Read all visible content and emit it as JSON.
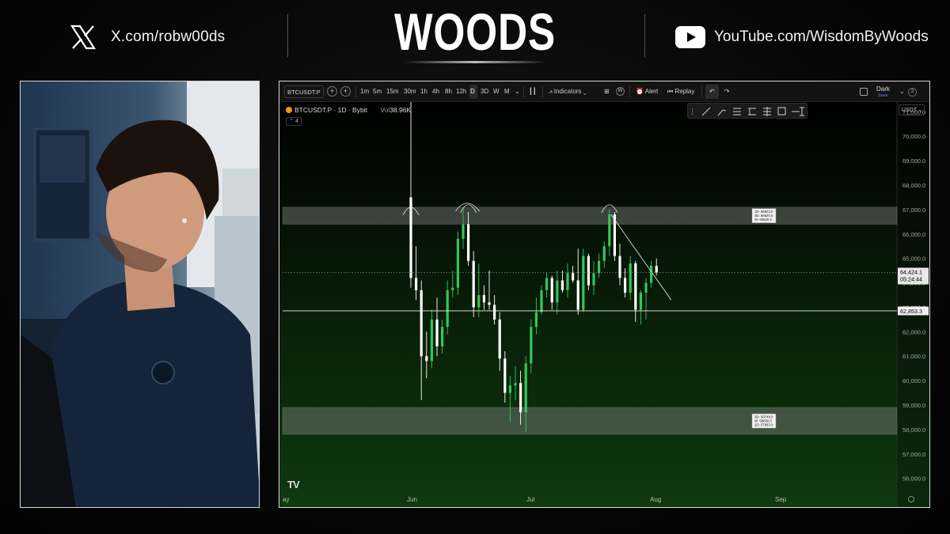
{
  "header": {
    "x_handle": "X.com/robw00ds",
    "brand": "WOODS",
    "youtube_handle": "YouTube.com/WisdomByWoods"
  },
  "icons": {
    "x": "x-logo-icon",
    "youtube": "youtube-play-icon"
  },
  "toolbar": {
    "symbol": "BTCUSDT.P",
    "intervals": [
      "1m",
      "5m",
      "15m",
      "30m",
      "1h",
      "4h",
      "8h",
      "12h",
      "D",
      "3D",
      "W",
      "M"
    ],
    "selected_interval": "D",
    "indicators_label": "Indicators",
    "alert_label": "Alert",
    "replay_label": "Replay",
    "theme_label": "Dark",
    "save_label": "Save",
    "layout_count": "2"
  },
  "legend": {
    "symbol_line": "BTCUSDT.P · 1D · Bybit",
    "vol_label": "Vol",
    "vol_value": "38.96K",
    "collapse_count": "4"
  },
  "price_scale": {
    "currency": "USDT"
  },
  "colors": {
    "up": "#34c759",
    "down": "#ffffff",
    "zone": "#8a8a8a",
    "background_top": "#000000",
    "background_bottom": "#0f3a0f"
  },
  "chart_data": {
    "type": "candlestick",
    "instrument": "BTCUSDT.P",
    "timeframe": "1D",
    "exchange": "Bybit",
    "y_ticks": [
      56000,
      57000,
      58000,
      59000,
      60000,
      61000,
      62000,
      63000,
      64000,
      65000,
      66000,
      67000,
      68000,
      69000,
      70000,
      71000
    ],
    "ylim": [
      55600,
      71400
    ],
    "x_tick_labels": [
      "ay",
      "Jun",
      "Jul",
      "Aug",
      "Sep"
    ],
    "last_price": "64,424.1",
    "countdown": "05:24:44",
    "horizontal_line": "62,853.3",
    "zones": [
      {
        "from": 66400,
        "to": 67100,
        "labels": [
          "1D: 66922.0",
          "3D: 66520.0",
          "W: 66520.0"
        ]
      },
      {
        "from": 57800,
        "to": 58900,
        "labels": [
          "3D: 58748.0",
          "W: 58650.0",
          "1D: 57993.0"
        ]
      }
    ],
    "candles": [
      {
        "o": 67500,
        "h": 71500,
        "l": 63800,
        "c": 64200
      },
      {
        "o": 64200,
        "h": 65500,
        "l": 63300,
        "c": 63700
      },
      {
        "o": 63700,
        "h": 64100,
        "l": 59200,
        "c": 61000
      },
      {
        "o": 61000,
        "h": 62000,
        "l": 60100,
        "c": 60800
      },
      {
        "o": 60800,
        "h": 62900,
        "l": 60500,
        "c": 62500
      },
      {
        "o": 62500,
        "h": 63400,
        "l": 61000,
        "c": 61400
      },
      {
        "o": 61400,
        "h": 62500,
        "l": 61100,
        "c": 62200
      },
      {
        "o": 62200,
        "h": 64100,
        "l": 61900,
        "c": 63700
      },
      {
        "o": 63700,
        "h": 64500,
        "l": 63400,
        "c": 63800
      },
      {
        "o": 63800,
        "h": 66100,
        "l": 63500,
        "c": 65800
      },
      {
        "o": 65800,
        "h": 67100,
        "l": 65400,
        "c": 66400
      },
      {
        "o": 66400,
        "h": 66900,
        "l": 64700,
        "c": 64900
      },
      {
        "o": 64900,
        "h": 65300,
        "l": 62600,
        "c": 63000
      },
      {
        "o": 63000,
        "h": 64800,
        "l": 62600,
        "c": 63500
      },
      {
        "o": 63500,
        "h": 63900,
        "l": 62900,
        "c": 63200
      },
      {
        "o": 63200,
        "h": 64500,
        "l": 62900,
        "c": 63100
      },
      {
        "o": 63100,
        "h": 63500,
        "l": 62300,
        "c": 62500
      },
      {
        "o": 62500,
        "h": 62800,
        "l": 60400,
        "c": 60900
      },
      {
        "o": 60900,
        "h": 61200,
        "l": 59100,
        "c": 59500
      },
      {
        "o": 59500,
        "h": 60200,
        "l": 58300,
        "c": 59800
      },
      {
        "o": 59800,
        "h": 60600,
        "l": 59200,
        "c": 59900
      },
      {
        "o": 59900,
        "h": 60400,
        "l": 58200,
        "c": 58700
      },
      {
        "o": 58700,
        "h": 61000,
        "l": 57900,
        "c": 60700
      },
      {
        "o": 60700,
        "h": 62500,
        "l": 60300,
        "c": 62200
      },
      {
        "o": 62200,
        "h": 63400,
        "l": 61900,
        "c": 62800
      },
      {
        "o": 62800,
        "h": 63900,
        "l": 62700,
        "c": 63700
      },
      {
        "o": 63700,
        "h": 64400,
        "l": 63400,
        "c": 64200
      },
      {
        "o": 64200,
        "h": 64300,
        "l": 62900,
        "c": 63200
      },
      {
        "o": 63200,
        "h": 64500,
        "l": 62700,
        "c": 64100
      },
      {
        "o": 64100,
        "h": 64500,
        "l": 63600,
        "c": 63700
      },
      {
        "o": 63700,
        "h": 64800,
        "l": 63400,
        "c": 64400
      },
      {
        "o": 64400,
        "h": 64700,
        "l": 64000,
        "c": 64100
      },
      {
        "o": 64100,
        "h": 65400,
        "l": 62700,
        "c": 62900
      },
      {
        "o": 62900,
        "h": 65400,
        "l": 62800,
        "c": 65100
      },
      {
        "o": 65100,
        "h": 65200,
        "l": 63700,
        "c": 63900
      },
      {
        "o": 63900,
        "h": 64900,
        "l": 63500,
        "c": 64400
      },
      {
        "o": 64400,
        "h": 65200,
        "l": 64200,
        "c": 64900
      },
      {
        "o": 64900,
        "h": 65700,
        "l": 64600,
        "c": 65500
      },
      {
        "o": 65500,
        "h": 67000,
        "l": 65100,
        "c": 66800
      },
      {
        "o": 66800,
        "h": 66900,
        "l": 64900,
        "c": 65100
      },
      {
        "o": 65100,
        "h": 65600,
        "l": 63900,
        "c": 64200
      },
      {
        "o": 64200,
        "h": 64600,
        "l": 63400,
        "c": 63600
      },
      {
        "o": 63600,
        "h": 65100,
        "l": 63300,
        "c": 64800
      },
      {
        "o": 64800,
        "h": 64900,
        "l": 62400,
        "c": 62900
      },
      {
        "o": 62900,
        "h": 63700,
        "l": 62300,
        "c": 63600
      },
      {
        "o": 63600,
        "h": 64200,
        "l": 62500,
        "c": 64000
      },
      {
        "o": 64000,
        "h": 64900,
        "l": 63800,
        "c": 64700
      },
      {
        "o": 64700,
        "h": 65000,
        "l": 64300,
        "c": 64424
      }
    ]
  }
}
